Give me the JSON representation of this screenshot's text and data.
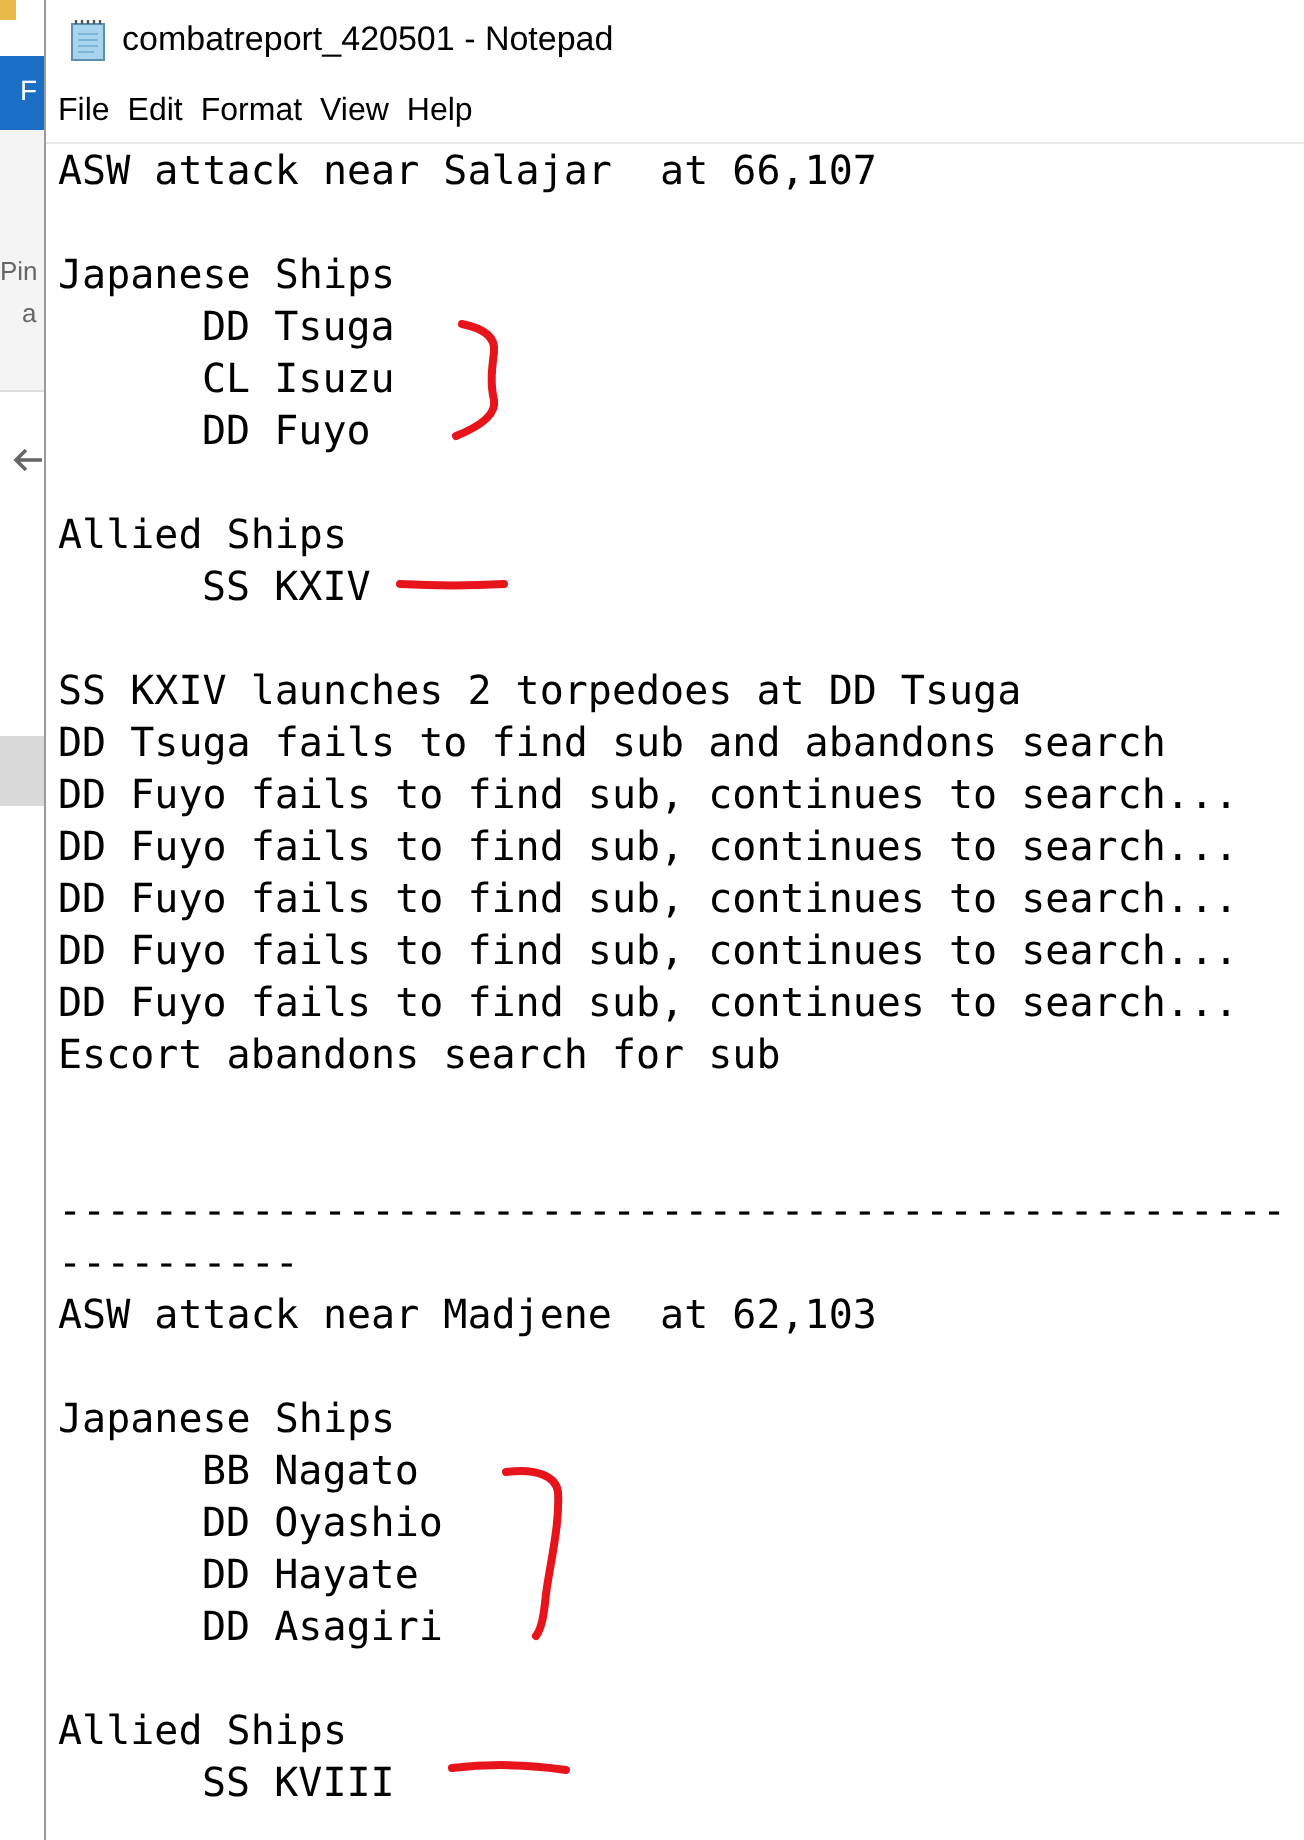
{
  "background_window": {
    "texts": [
      "F",
      "Pin",
      "a"
    ]
  },
  "window": {
    "title": "combatreport_420501 - Notepad"
  },
  "menu": [
    "File",
    "Edit",
    "Format",
    "View",
    "Help"
  ],
  "lines": [
    {
      "kind": "text",
      "text": "ASW attack near Salajar  at 66,107",
      "indented": false
    },
    {
      "kind": "blank"
    },
    {
      "kind": "text",
      "text": "Japanese Ships",
      "indented": false
    },
    {
      "kind": "text",
      "text": "DD Tsuga",
      "indented": true
    },
    {
      "kind": "text",
      "text": "CL Isuzu",
      "indented": true
    },
    {
      "kind": "text",
      "text": "DD Fuyo",
      "indented": true
    },
    {
      "kind": "blank"
    },
    {
      "kind": "text",
      "text": "Allied Ships",
      "indented": false
    },
    {
      "kind": "text",
      "text": "SS KXIV",
      "indented": true
    },
    {
      "kind": "blank"
    },
    {
      "kind": "text",
      "text": "SS KXIV launches 2 torpedoes at DD Tsuga",
      "indented": false
    },
    {
      "kind": "text",
      "text": "DD Tsuga fails to find sub and abandons search",
      "indented": false
    },
    {
      "kind": "text",
      "text": "DD Fuyo fails to find sub, continues to search...",
      "indented": false
    },
    {
      "kind": "text",
      "text": "DD Fuyo fails to find sub, continues to search...",
      "indented": false
    },
    {
      "kind": "text",
      "text": "DD Fuyo fails to find sub, continues to search...",
      "indented": false
    },
    {
      "kind": "text",
      "text": "DD Fuyo fails to find sub, continues to search...",
      "indented": false
    },
    {
      "kind": "text",
      "text": "DD Fuyo fails to find sub, continues to search...",
      "indented": false
    },
    {
      "kind": "text",
      "text": "Escort abandons search for sub",
      "indented": false
    },
    {
      "kind": "blank"
    },
    {
      "kind": "blank"
    },
    {
      "kind": "text",
      "text": "---------------------------------------------------",
      "indented": false
    },
    {
      "kind": "text",
      "text": "----------",
      "indented": false
    },
    {
      "kind": "text",
      "text": "ASW attack near Madjene  at 62,103",
      "indented": false
    },
    {
      "kind": "blank"
    },
    {
      "kind": "text",
      "text": "Japanese Ships",
      "indented": false
    },
    {
      "kind": "text",
      "text": "BB Nagato",
      "indented": true
    },
    {
      "kind": "text",
      "text": "DD Oyashio",
      "indented": true
    },
    {
      "kind": "text",
      "text": "DD Hayate",
      "indented": true
    },
    {
      "kind": "text",
      "text": "DD Asagiri",
      "indented": true
    },
    {
      "kind": "blank"
    },
    {
      "kind": "text",
      "text": "Allied Ships",
      "indented": false
    },
    {
      "kind": "text",
      "text": "SS KVIII",
      "indented": true
    }
  ]
}
